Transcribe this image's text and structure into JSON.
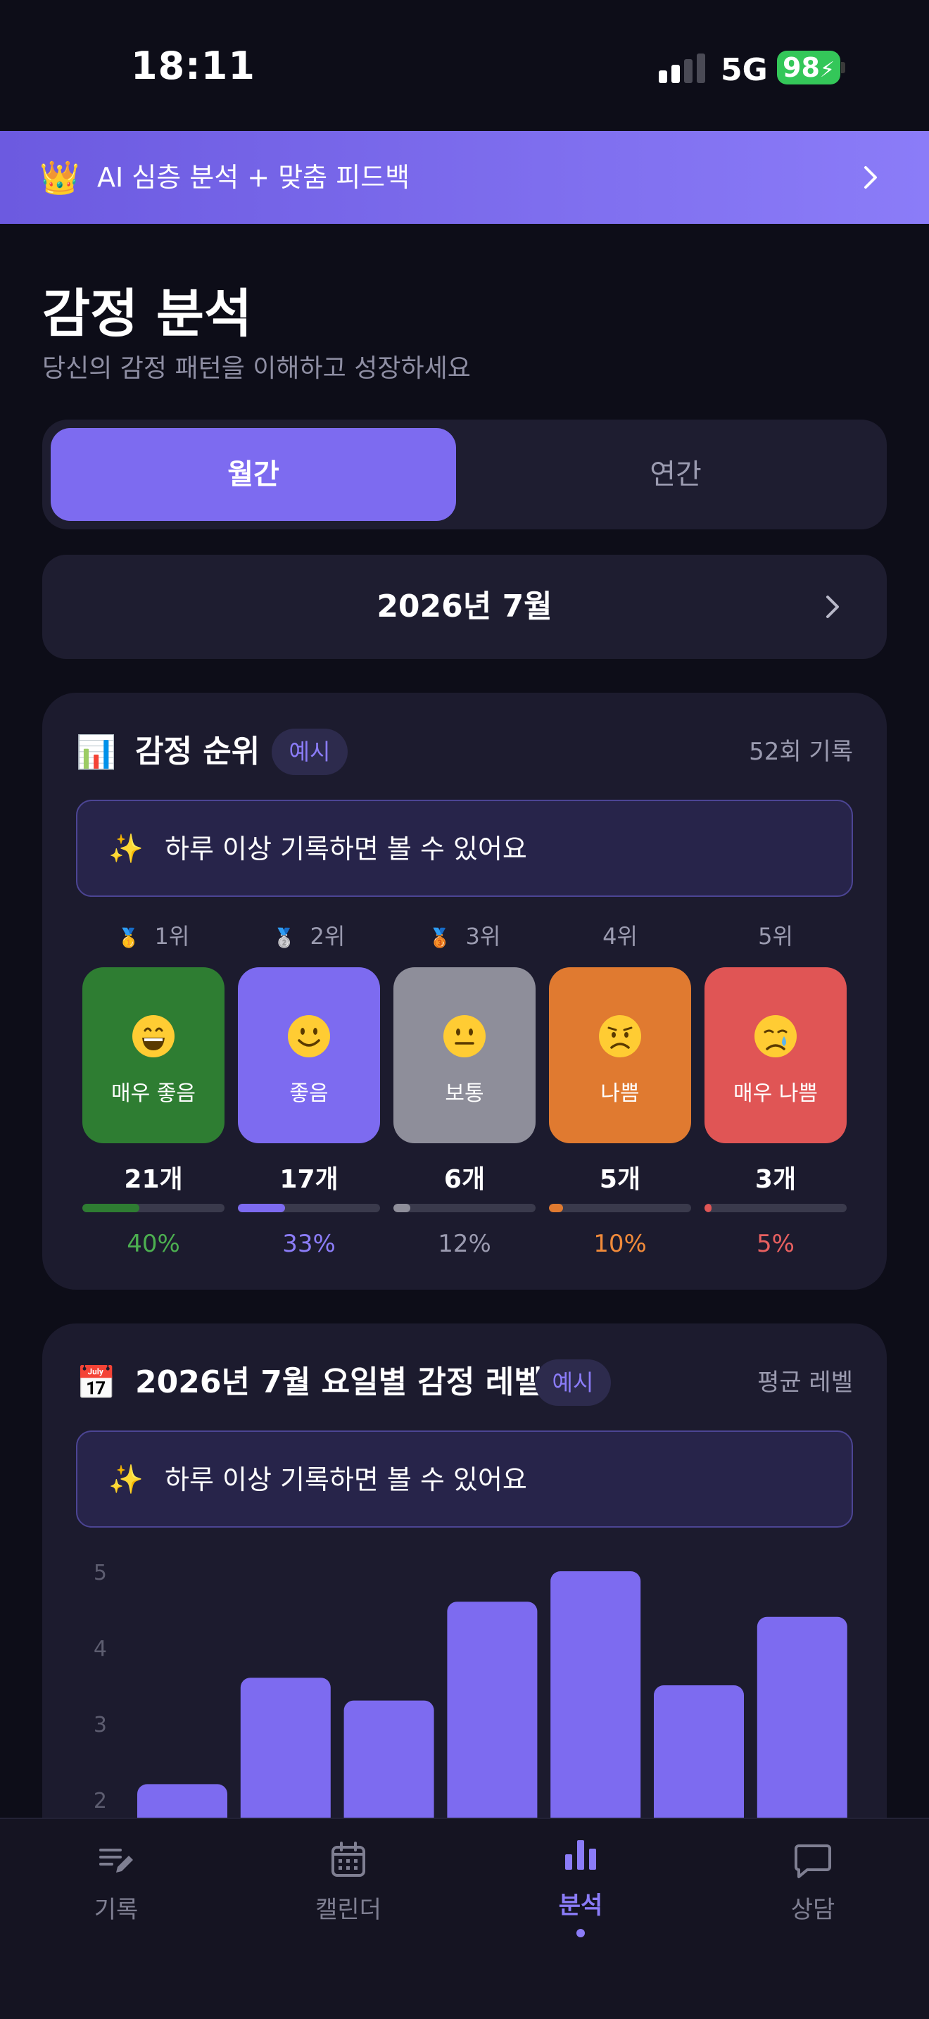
{
  "status_bar": {
    "time": "18:11",
    "network": "5G",
    "battery": "98"
  },
  "promo": {
    "icon": "crown-icon",
    "text": "AI 심층 분석 + 맞춤 피드백"
  },
  "header": {
    "title": "감정 분석",
    "subtitle": "당신의 감정 패턴을 이해하고 성장하세요"
  },
  "period_tabs": [
    {
      "label": "월간",
      "active": true
    },
    {
      "label": "연간",
      "active": false
    }
  ],
  "month_selector": {
    "label": "2026년 7월"
  },
  "ranking_card": {
    "icon": "bar-chart-icon",
    "title": "감정 순위",
    "badge": "예시",
    "meta": "52회 기록",
    "notice": "하루 이상 기록하면 볼 수 있어요",
    "items": [
      {
        "rank": "1위",
        "medal": "gold-medal-icon",
        "emotion": "very-happy-face-icon",
        "name": "매우 좋음",
        "count": "21개",
        "percent": "40%",
        "value": 0.4,
        "color": "#2e7d32",
        "text_color": "#4caf50"
      },
      {
        "rank": "2위",
        "medal": "silver-medal-icon",
        "emotion": "smile-face-icon",
        "name": "좋음",
        "count": "17개",
        "percent": "33%",
        "value": 0.33,
        "color": "#7d6bf0",
        "text_color": "#8b7cf8"
      },
      {
        "rank": "3위",
        "medal": "bronze-medal-icon",
        "emotion": "neutral-face-icon",
        "name": "보통",
        "count": "6개",
        "percent": "12%",
        "value": 0.12,
        "color": "#8e8e9a",
        "text_color": "#9b9bb0"
      },
      {
        "rank": "4위",
        "medal": "",
        "emotion": "sad-face-icon",
        "name": "나쁨",
        "count": "5개",
        "percent": "10%",
        "value": 0.1,
        "color": "#e07a30",
        "text_color": "#f08a3a"
      },
      {
        "rank": "5위",
        "medal": "",
        "emotion": "crying-face-icon",
        "name": "매우 나쁨",
        "count": "3개",
        "percent": "5%",
        "value": 0.05,
        "color": "#e05555",
        "text_color": "#e86060"
      }
    ]
  },
  "weekday_card": {
    "icon": "calendar-icon",
    "title": "2026년 7월 요일별 감정 레벨",
    "badge": "예시",
    "meta": "평균 레벨",
    "notice": "하루 이상 기록하면 볼 수 있어요"
  },
  "chart_data": {
    "type": "bar",
    "yticks": [
      "5",
      "4",
      "3",
      "2"
    ],
    "ylim": [
      0,
      5
    ],
    "values": [
      2.2,
      3.6,
      3.3,
      4.6,
      5.0,
      3.5,
      4.4
    ],
    "color": "#7d6bf0"
  },
  "tabbar": [
    {
      "label": "기록",
      "icon": "note-edit-icon",
      "active": false
    },
    {
      "label": "캘린더",
      "icon": "calendar-grid-icon",
      "active": false
    },
    {
      "label": "분석",
      "icon": "bar-chart-icon",
      "active": true
    },
    {
      "label": "상담",
      "icon": "chat-bubble-icon",
      "active": false
    }
  ]
}
